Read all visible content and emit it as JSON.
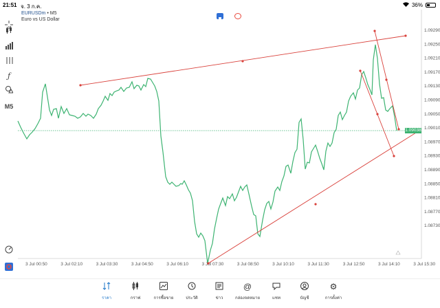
{
  "status": {
    "time": "21:51",
    "date": "จ. 3 ก.ค.",
    "battery": "36%",
    "battery_level": 0.36
  },
  "symbol": {
    "name": "EURUSDm",
    "timeframe": "M5",
    "description": "Euro vs US Dollar"
  },
  "toolbar": {
    "timeframe_label": "M5"
  },
  "current_price": "1.09038",
  "price_axis": [
    "1.09290",
    "1.09250",
    "1.09210",
    "1.09170",
    "1.09130",
    "1.09090",
    "1.09050",
    "1.09010",
    "1.08970",
    "1.08930",
    "1.08890",
    "1.08850",
    "1.08810",
    "1.08770",
    "1.08730"
  ],
  "time_axis": [
    "3 Jul 00:50",
    "3 Jul 02:10",
    "3 Jul 03:30",
    "3 Jul 04:50",
    "3 Jul 06:10",
    "3 Jul 07:30",
    "3 Jul 08:50",
    "3 Jul 10:10",
    "3 Jul 11:30",
    "3 Jul 12:50",
    "3 Jul 14:10",
    "3 Jul 15:30"
  ],
  "colors": {
    "line": "#3cb371",
    "trendline": "#d9403a",
    "accent": "#1f77c9"
  },
  "nav": [
    {
      "label": "ราคา",
      "icon": "sort-icon",
      "active": true
    },
    {
      "label": "กราฟ",
      "icon": "candles-icon",
      "active": false
    },
    {
      "label": "การซื้อขาย",
      "icon": "trade-chart-icon",
      "active": false
    },
    {
      "label": "ประวัติ",
      "icon": "history-icon",
      "active": false
    },
    {
      "label": "ข่าว",
      "icon": "news-icon",
      "active": false
    },
    {
      "label": "กล่องจดหมาย",
      "icon": "at-icon",
      "active": false
    },
    {
      "label": "แชท",
      "icon": "chat-icon",
      "active": false
    },
    {
      "label": "บัญชี",
      "icon": "account-icon",
      "active": false
    },
    {
      "label": "การตั้งค่า",
      "icon": "gear-icon",
      "active": false
    }
  ]
}
